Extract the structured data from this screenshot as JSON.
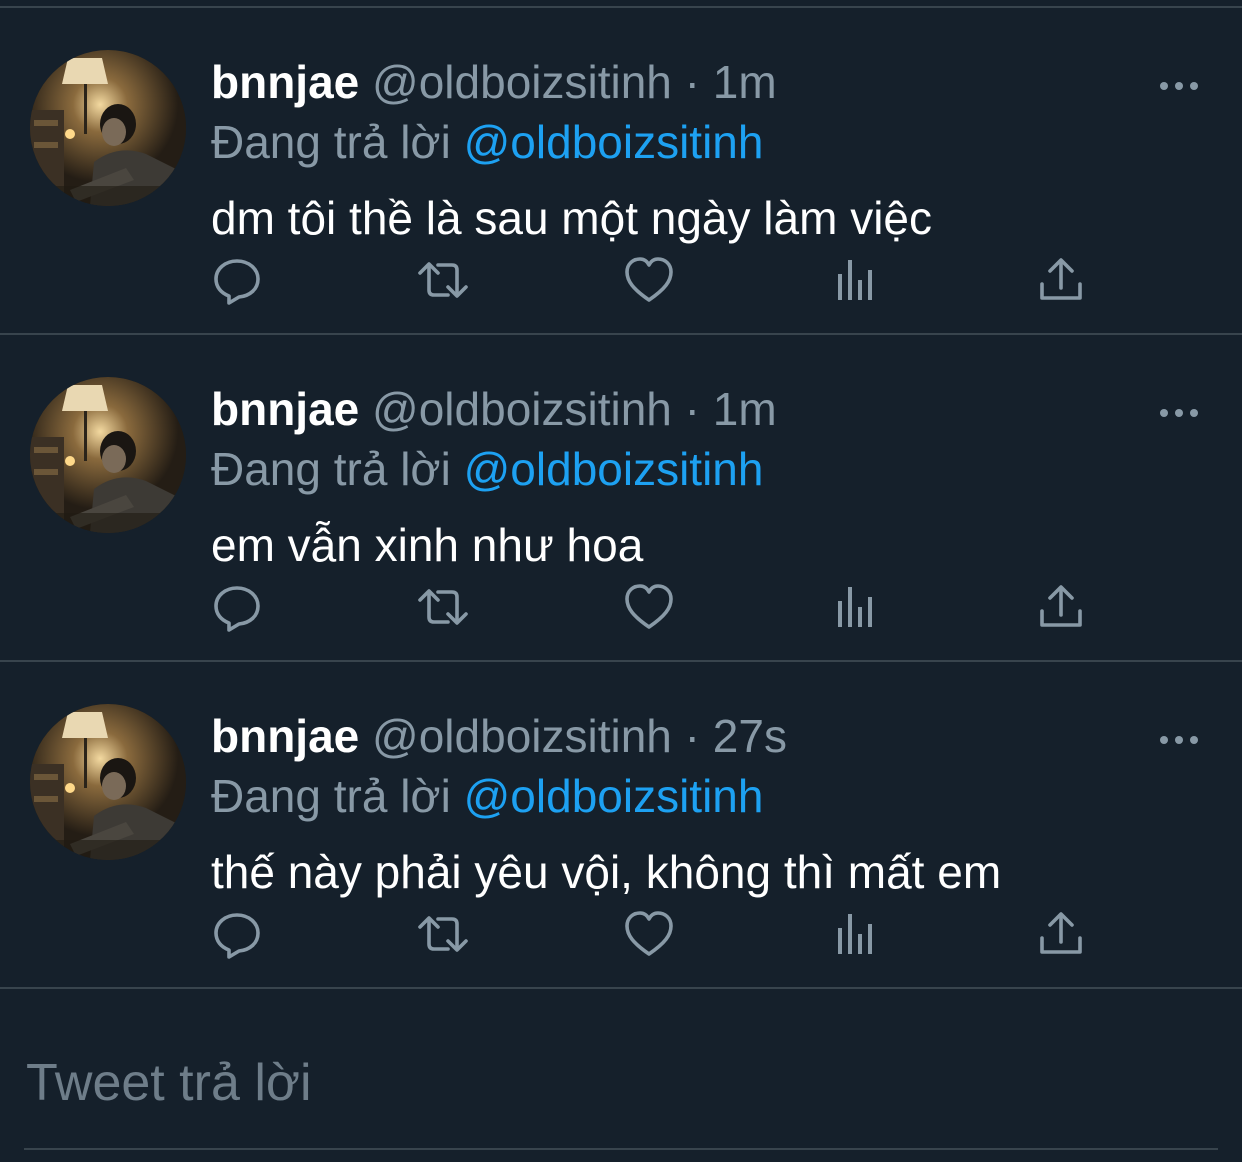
{
  "colors": {
    "background": "#15202b",
    "divider": "#38444d",
    "primary_text": "#ffffff",
    "secondary_text": "#8899a6",
    "accent": "#1da1f2"
  },
  "tweets": [
    {
      "display_name": "bnnjae",
      "handle": "@oldboizsitinh",
      "separator": "·",
      "time": "1m",
      "reply_prefix": "Đang trả lời",
      "reply_mention": "@oldboizsitinh",
      "text": "dm tôi thề là sau một ngày làm việc",
      "actions": [
        "reply-icon",
        "retweet-icon",
        "like-icon",
        "analytics-icon",
        "share-icon"
      ]
    },
    {
      "display_name": "bnnjae",
      "handle": "@oldboizsitinh",
      "separator": "·",
      "time": "1m",
      "reply_prefix": "Đang trả lời",
      "reply_mention": "@oldboizsitinh",
      "text": "em vẫn xinh như hoa",
      "actions": [
        "reply-icon",
        "retweet-icon",
        "like-icon",
        "analytics-icon",
        "share-icon"
      ]
    },
    {
      "display_name": "bnnjae",
      "handle": "@oldboizsitinh",
      "separator": "·",
      "time": "27s",
      "reply_prefix": "Đang trả lời",
      "reply_mention": "@oldboizsitinh",
      "text": "thế này phải yêu vội, không thì mất em",
      "actions": [
        "reply-icon",
        "retweet-icon",
        "like-icon",
        "analytics-icon",
        "share-icon"
      ]
    }
  ],
  "reply_box": {
    "placeholder": "Tweet trả lời"
  }
}
